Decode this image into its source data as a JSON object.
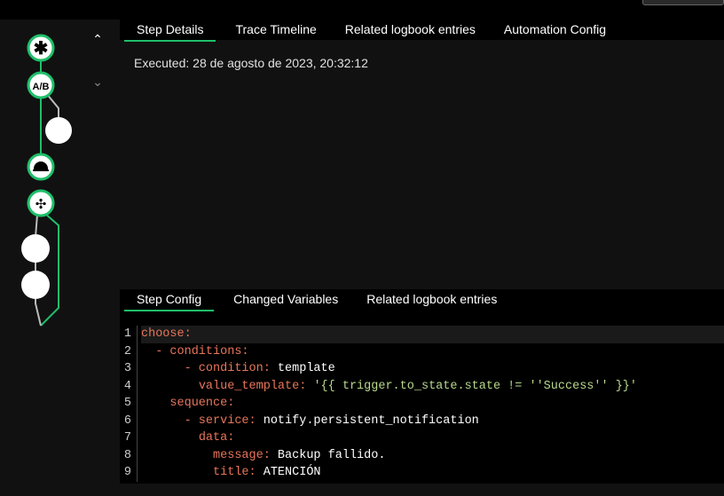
{
  "top_tabs": [
    "Step Details",
    "Trace Timeline",
    "Related logbook entries",
    "Automation Config"
  ],
  "executed": "Executed: 28 de agosto de 2023, 20:32:12",
  "lower_tabs": [
    "Step Config",
    "Changed Variables",
    "Related logbook entries"
  ],
  "code": {
    "line_numbers": [
      "1",
      "2",
      "3",
      "4",
      "5",
      "6",
      "7",
      "8",
      "9"
    ],
    "lines": [
      {
        "indent": "",
        "key": "choose:",
        "value": ""
      },
      {
        "indent": "  ",
        "key": "- conditions:",
        "value": ""
      },
      {
        "indent": "      ",
        "key": "- condition:",
        "value": " template"
      },
      {
        "indent": "        ",
        "key": "value_template:",
        "value": " '{{ trigger.to_state.state != ''Success'' }}'"
      },
      {
        "indent": "    ",
        "key": "sequence:",
        "value": ""
      },
      {
        "indent": "      ",
        "key": "- service:",
        "value": " notify.persistent_notification"
      },
      {
        "indent": "        ",
        "key": "data:",
        "value": ""
      },
      {
        "indent": "          ",
        "key": "message:",
        "value": " Backup fallido."
      },
      {
        "indent": "          ",
        "key": "title:",
        "value": " ATENCIÓN"
      }
    ]
  },
  "colors": {
    "accent": "#1fbf6a",
    "key": "#e8755a",
    "string": "#b7d98b"
  }
}
